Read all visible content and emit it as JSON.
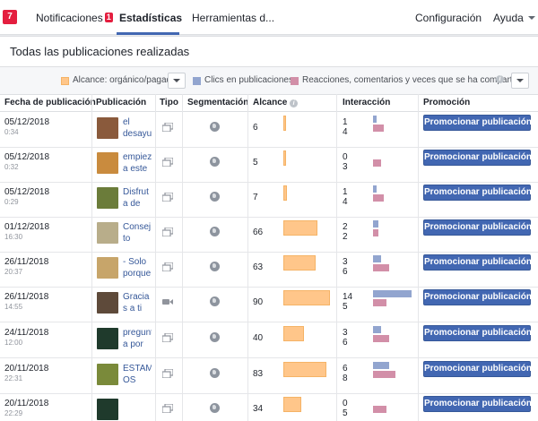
{
  "nav": {
    "notif_badge": "7",
    "notifications_label": "Notificaciones",
    "notifications_count": "1",
    "stats_label": "Estadísticas",
    "tools_label": "Herramientas d...",
    "config_label": "Configuración",
    "help_label": "Ayuda"
  },
  "panel": {
    "title": "Todas las publicaciones realizadas",
    "legend": {
      "reach_label": "Alcance: orgánico/pagado",
      "clicks_label": "Clics en publicaciones",
      "reactions_label": "Reacciones, comentarios y veces que se ha compartido"
    },
    "columns": {
      "date": "Fecha de publicación",
      "post": "Publicación",
      "type": "Tipo",
      "targeting": "Segmentación",
      "reach": "Alcance",
      "interaction": "Interacción",
      "promotion": "Promoción"
    },
    "colors": {
      "reach": "#ffc68a",
      "clicks": "#92a5cf",
      "reactions": "#d28fa8",
      "promote": "#4267b2"
    }
  },
  "rows": [
    {
      "date": "05/12/2018",
      "time": "0:34",
      "text": "el desayu",
      "type_icon": "album-icon",
      "reach": "6",
      "reach_value": 6,
      "clicks": "1",
      "reactions": "4",
      "clicks_value": 1,
      "reactions_value": 4,
      "promote": "Promocionar publicación",
      "thumb_color": "#8a5a3c"
    },
    {
      "date": "05/12/2018",
      "time": "0:32",
      "text": "empiez a este",
      "type_icon": "album-icon",
      "reach": "5",
      "reach_value": 5,
      "clicks": "0",
      "reactions": "3",
      "clicks_value": 0,
      "reactions_value": 3,
      "promote": "Promocionar publicación",
      "thumb_color": "#c98b3e"
    },
    {
      "date": "05/12/2018",
      "time": "0:29",
      "text": "Disfrut a de un",
      "type_icon": "album-icon",
      "reach": "7",
      "reach_value": 7,
      "clicks": "1",
      "reactions": "4",
      "clicks_value": 1,
      "reactions_value": 4,
      "promote": "Promocionar publicación",
      "thumb_color": "#6b7c3a"
    },
    {
      "date": "01/12/2018",
      "time": "16:30",
      "text": "Consej to",
      "type_icon": "album-icon",
      "reach": "66",
      "reach_value": 66,
      "clicks": "2",
      "reactions": "2",
      "clicks_value": 2,
      "reactions_value": 2,
      "promote": "Promocionar publicación",
      "thumb_color": "#b8ad8a"
    },
    {
      "date": "26/11/2018",
      "time": "20:37",
      "text": "- Solo porque",
      "type_icon": "album-icon",
      "reach": "63",
      "reach_value": 63,
      "clicks": "3",
      "reactions": "6",
      "clicks_value": 3,
      "reactions_value": 6,
      "promote": "Promocionar publicación",
      "thumb_color": "#c7a56a"
    },
    {
      "date": "26/11/2018",
      "time": "14:55",
      "text": "Gracia s a ti",
      "type_icon": "video-icon",
      "reach": "90",
      "reach_value": 90,
      "clicks": "14",
      "reactions": "5",
      "clicks_value": 14,
      "reactions_value": 5,
      "promote": "Promocionar publicación",
      "thumb_color": "#5e4a3a"
    },
    {
      "date": "24/11/2018",
      "time": "12:00",
      "text": "pregunt a por",
      "type_icon": "album-icon",
      "reach": "40",
      "reach_value": 40,
      "clicks": "3",
      "reactions": "6",
      "clicks_value": 3,
      "reactions_value": 6,
      "promote": "Promocionar publicación",
      "thumb_color": "#1f3a2c"
    },
    {
      "date": "20/11/2018",
      "time": "22:31",
      "text": "ESTAM OS",
      "type_icon": "album-icon",
      "reach": "83",
      "reach_value": 83,
      "clicks": "6",
      "reactions": "8",
      "clicks_value": 6,
      "reactions_value": 8,
      "promote": "Promocionar publicación",
      "thumb_color": "#7a8a3a"
    },
    {
      "date": "20/11/2018",
      "time": "22:29",
      "text": "",
      "type_icon": "album-icon",
      "reach": "34",
      "reach_value": 34,
      "clicks": "0",
      "reactions": "5",
      "clicks_value": 0,
      "reactions_value": 5,
      "promote": "Promocionar publicación",
      "thumb_color": "#1f3a2c"
    }
  ]
}
